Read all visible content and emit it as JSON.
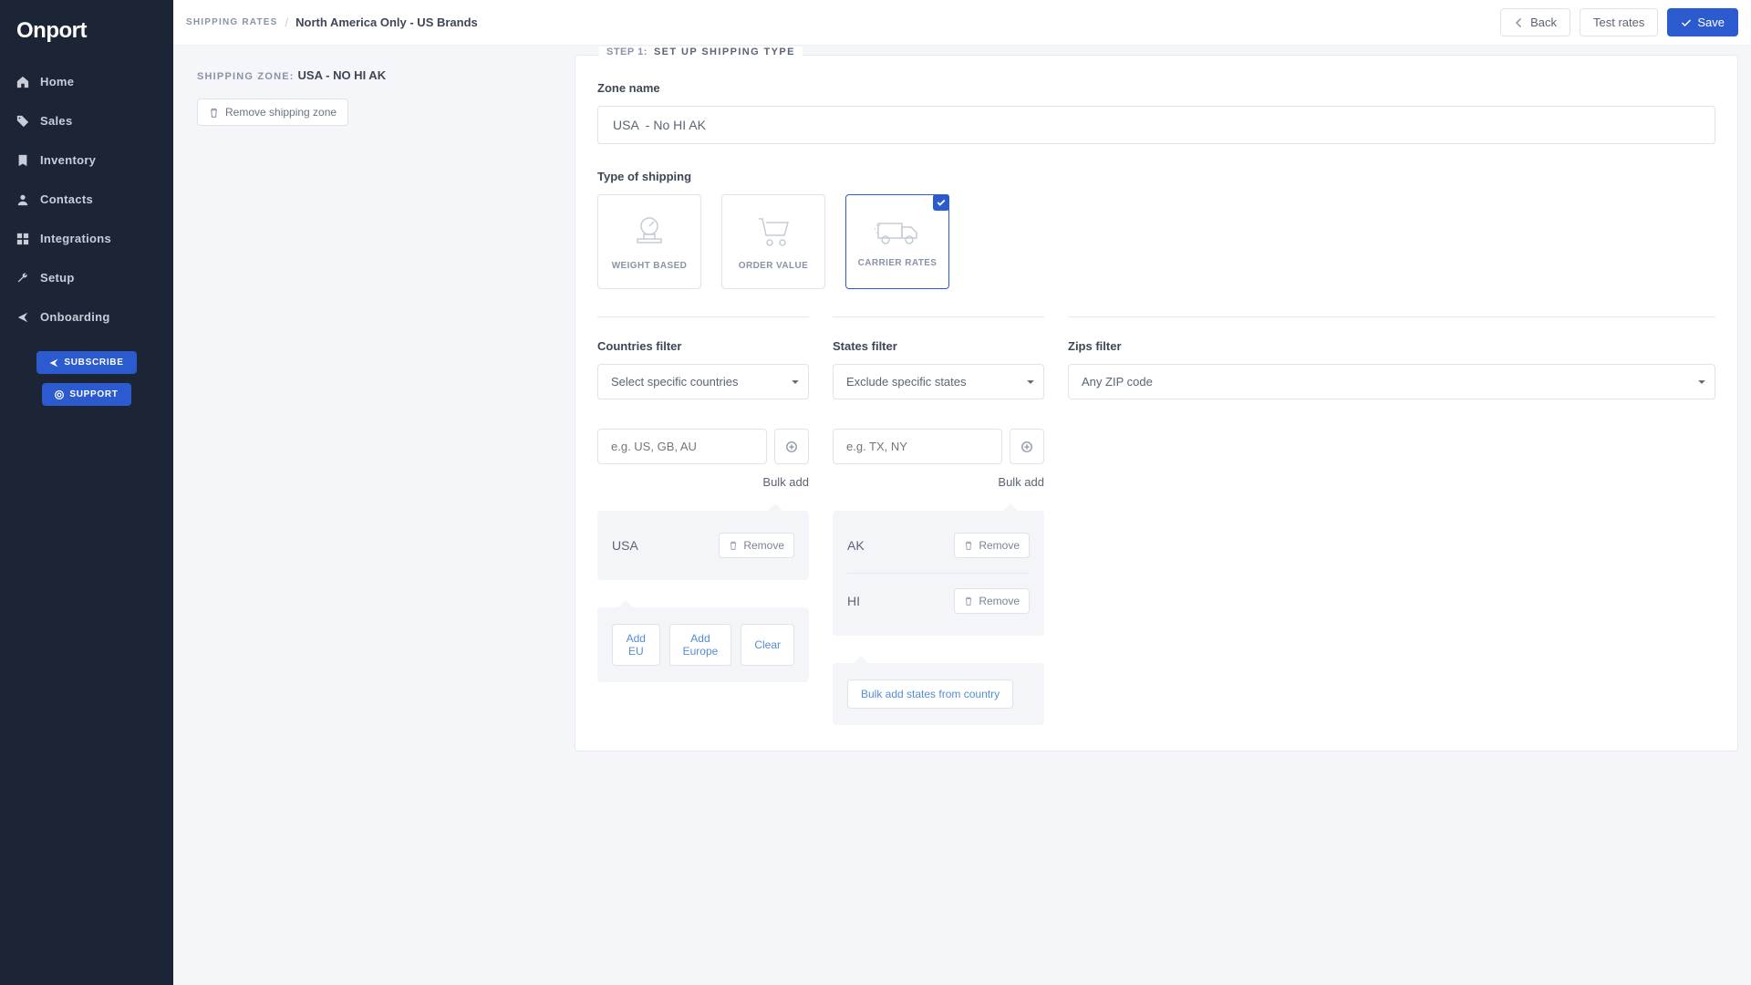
{
  "brand": "Onport",
  "nav": {
    "items": [
      {
        "label": "Home",
        "icon": "home"
      },
      {
        "label": "Sales",
        "icon": "tag"
      },
      {
        "label": "Inventory",
        "icon": "bookmark"
      },
      {
        "label": "Contacts",
        "icon": "user"
      },
      {
        "label": "Integrations",
        "icon": "grid"
      },
      {
        "label": "Setup",
        "icon": "wrench"
      },
      {
        "label": "Onboarding",
        "icon": "arrow"
      }
    ],
    "subscribe": "SUBSCRIBE",
    "support": "SUPPORT"
  },
  "breadcrumb": {
    "root": "SHIPPING RATES",
    "current": "North America Only - US Brands"
  },
  "actions": {
    "back": "Back",
    "test": "Test rates",
    "save": "Save"
  },
  "zone": {
    "title_label": "SHIPPING ZONE:",
    "title_value": "USA - NO HI AK",
    "remove": "Remove shipping zone"
  },
  "step": {
    "num": "STEP 1:",
    "name": "SET UP SHIPPING TYPE",
    "zone_name_label": "Zone name",
    "zone_name_value": "USA  - No HI AK",
    "type_label": "Type of shipping",
    "types": {
      "weight": "WEIGHT BASED",
      "order": "ORDER VALUE",
      "carrier": "CARRIER RATES"
    }
  },
  "filters": {
    "countries": {
      "label": "Countries filter",
      "select": "Select specific countries",
      "placeholder": "e.g. US, GB, AU",
      "bulk": "Bulk add",
      "tags": [
        {
          "name": "USA"
        }
      ],
      "remove": "Remove",
      "qa_eu": "Add EU",
      "qa_europe": "Add Europe",
      "qa_clear": "Clear"
    },
    "states": {
      "label": "States filter",
      "select": "Exclude specific states",
      "placeholder": "e.g. TX, NY",
      "bulk": "Bulk add",
      "tags": [
        {
          "name": "AK"
        },
        {
          "name": "HI"
        }
      ],
      "remove": "Remove",
      "qa_bulk_country": "Bulk add states from country"
    },
    "zips": {
      "label": "Zips filter",
      "select": "Any ZIP code"
    }
  }
}
